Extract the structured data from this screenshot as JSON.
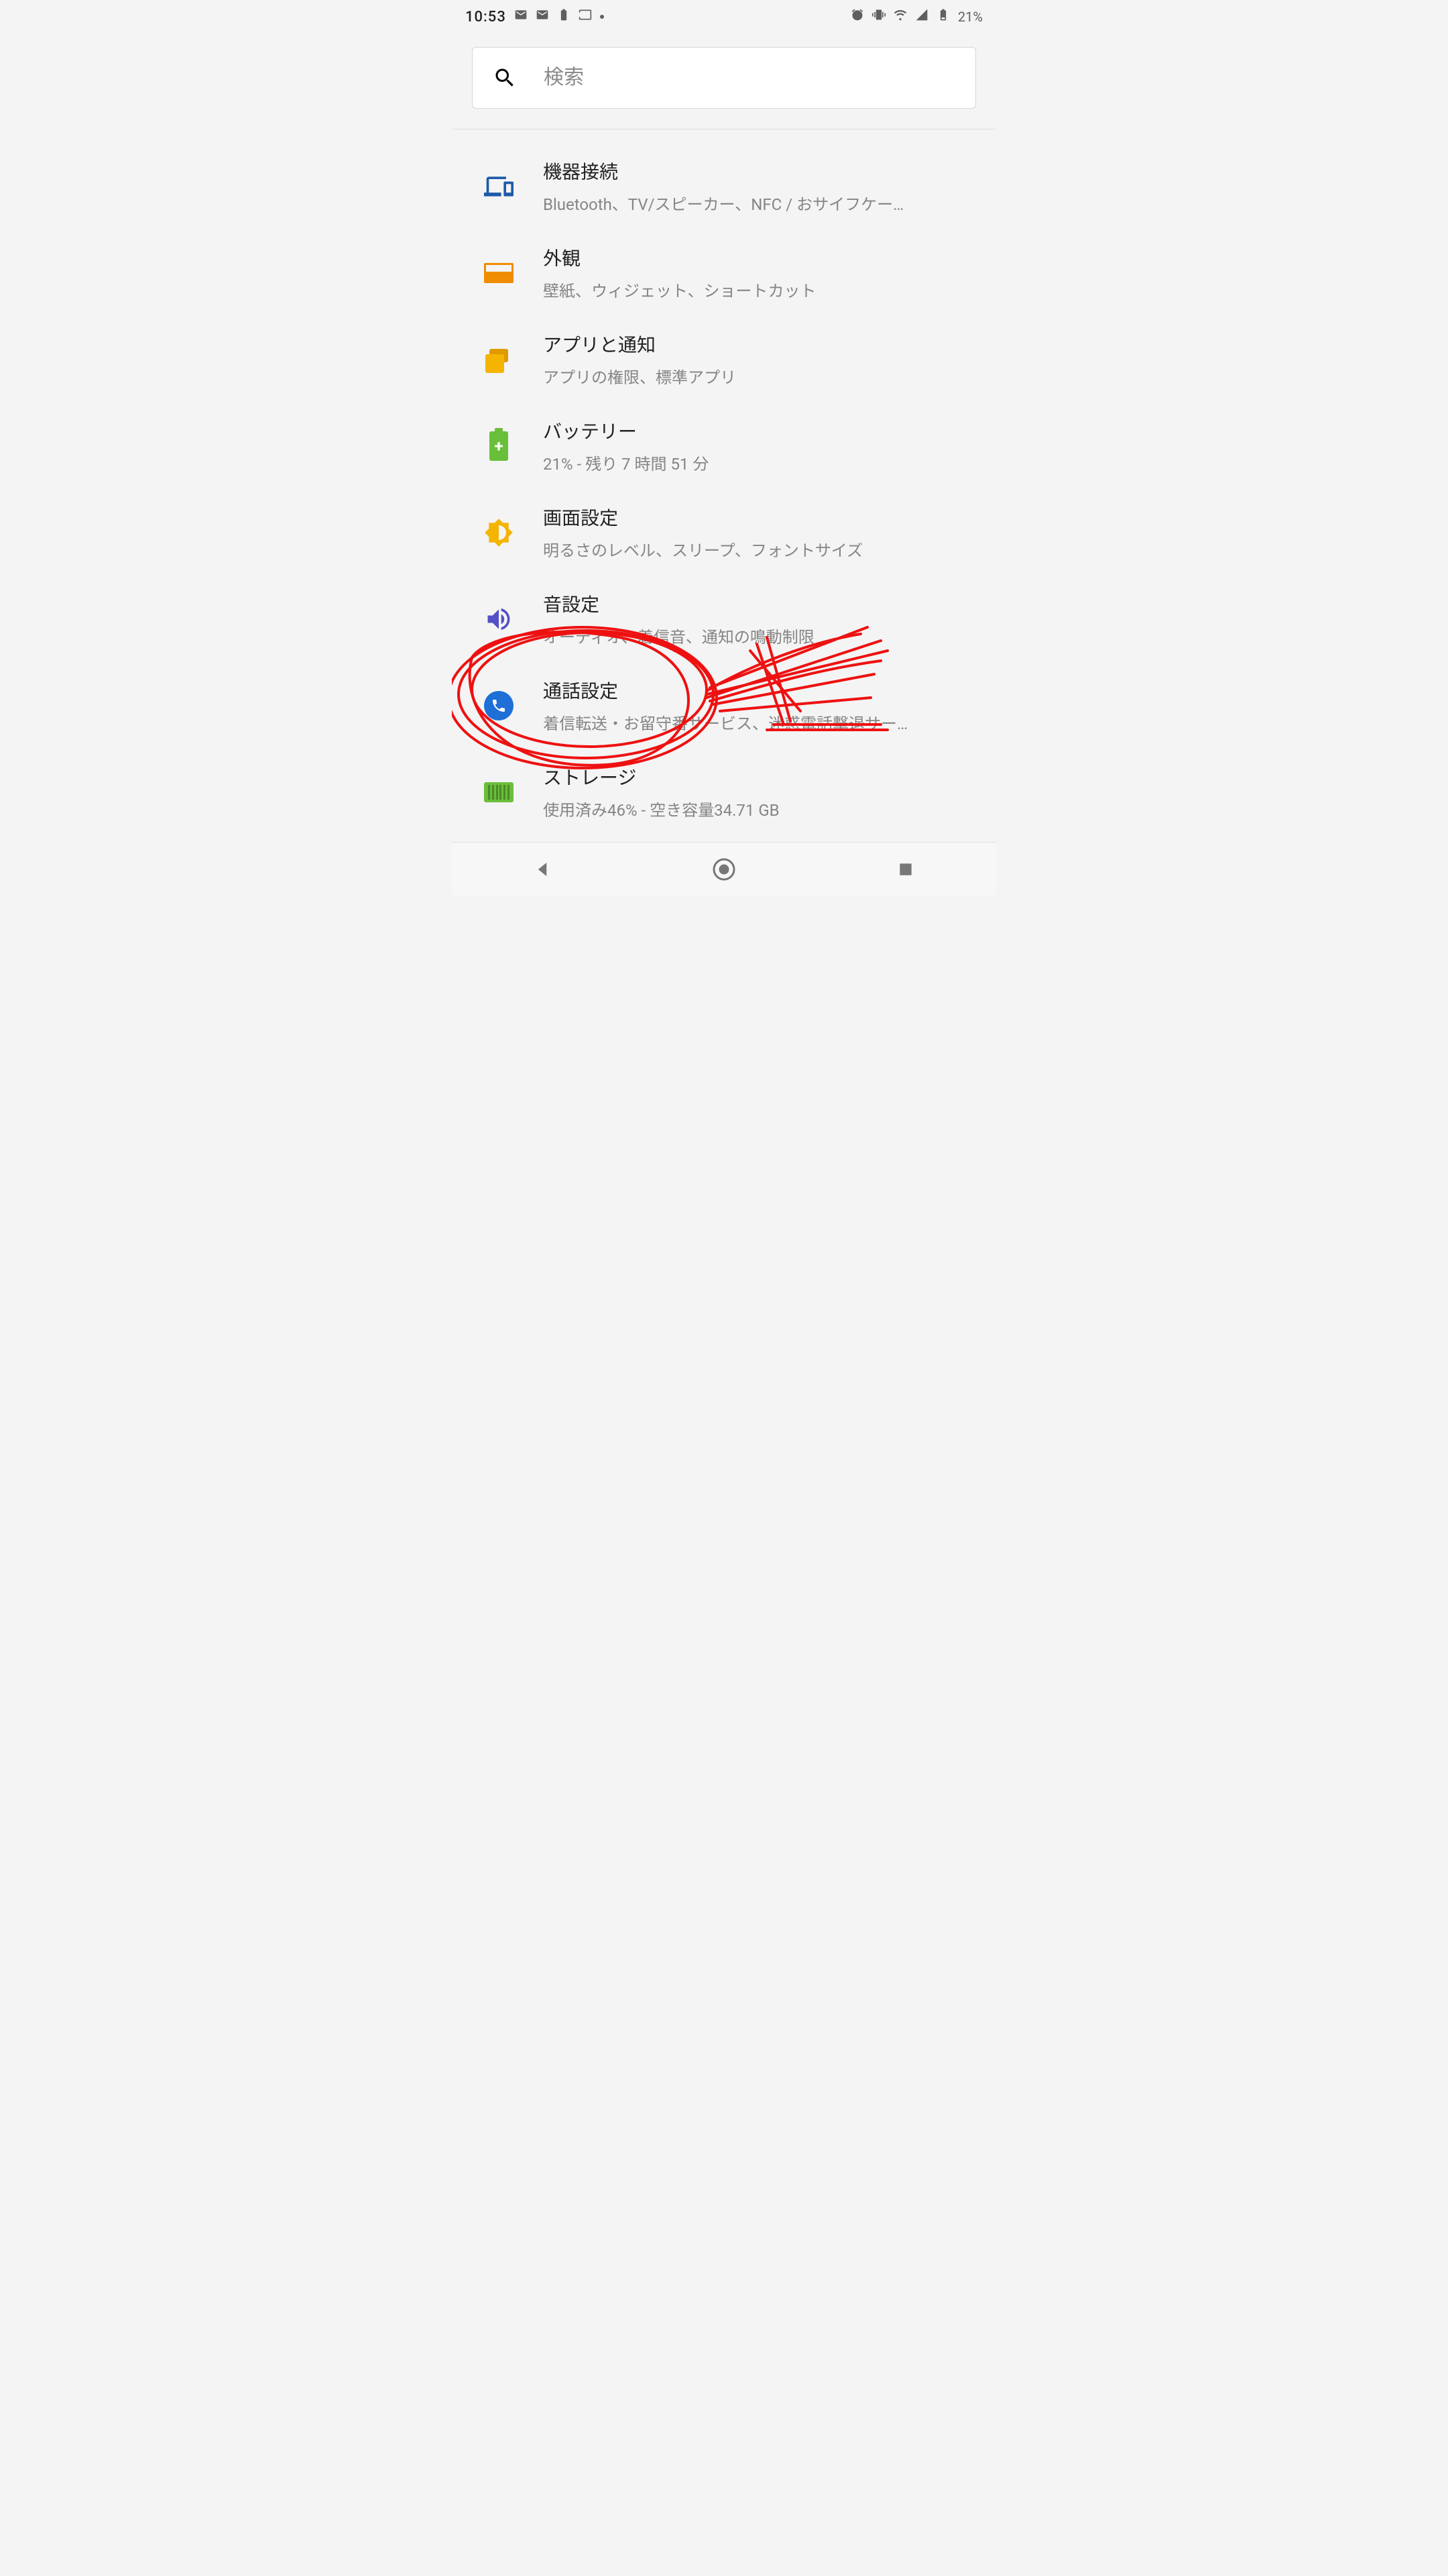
{
  "status": {
    "clock": "10:53",
    "battery_pct": "21%"
  },
  "search": {
    "placeholder": "検索"
  },
  "rows": [
    {
      "id": "device-connection",
      "icon": "devices",
      "title": "機器接続",
      "sub": "Bluetooth、TV/スピーカー、NFC / おサイフケー…"
    },
    {
      "id": "appearance",
      "icon": "appearance",
      "title": "外観",
      "sub": "壁紙、ウィジェット、ショートカット"
    },
    {
      "id": "apps",
      "icon": "apps",
      "title": "アプリと通知",
      "sub": "アプリの権限、標準アプリ"
    },
    {
      "id": "battery",
      "icon": "battery",
      "title": "バッテリー",
      "sub": "21% - 残り 7 時間  51 分"
    },
    {
      "id": "display",
      "icon": "display",
      "title": "画面設定",
      "sub": "明るさのレベル、スリープ、フォントサイズ"
    },
    {
      "id": "sound",
      "icon": "sound",
      "title": "音設定",
      "sub": "オーディオ、着信音、通知の鳴動制限"
    },
    {
      "id": "call",
      "icon": "call",
      "title": "通話設定",
      "sub": "着信転送・お留守番サービス、迷惑電話撃退サー…"
    },
    {
      "id": "storage",
      "icon": "storage",
      "title": "ストレージ",
      "sub": "使用済み46% - 空き容量34.71 GB"
    }
  ],
  "annotation": {
    "target_row": "sound",
    "description": "red hand-drawn circles and arrow highlighting 音設定"
  }
}
